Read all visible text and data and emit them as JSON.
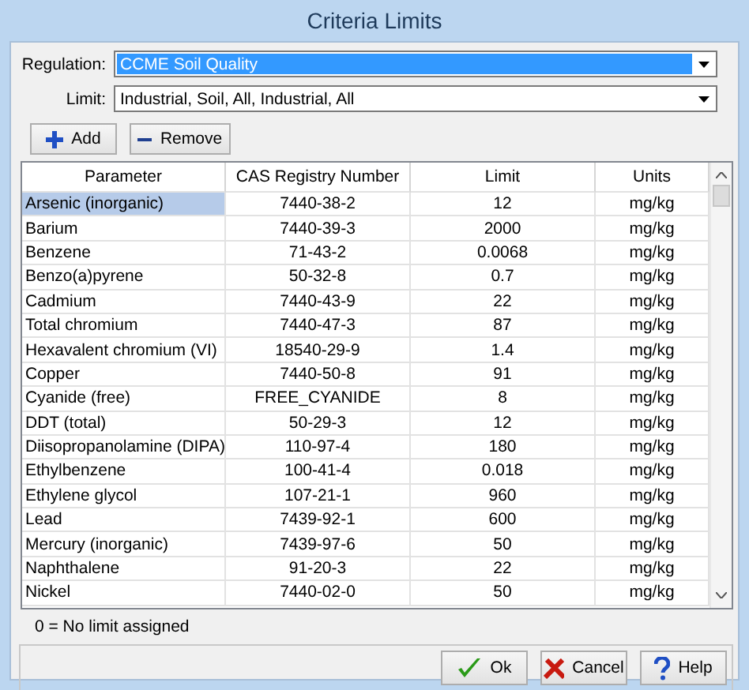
{
  "window": {
    "title": "Criteria Limits"
  },
  "regulation": {
    "label": "Regulation:",
    "value": "CCME Soil Quality",
    "highlighted": true
  },
  "limit": {
    "label": "Limit:",
    "value": "Industrial, Soil, All, Industrial, All",
    "highlighted": false
  },
  "toolbar": [
    {
      "kind": "add",
      "label": "Add"
    },
    {
      "kind": "remove",
      "label": "Remove"
    }
  ],
  "table": {
    "columns": [
      "Parameter",
      "CAS Registry Number",
      "Limit",
      "Units"
    ],
    "rows": [
      {
        "cells": [
          "Arsenic (inorganic)",
          "7440-38-2",
          "12",
          "mg/kg"
        ],
        "selected": true
      },
      {
        "cells": [
          "Barium",
          "7440-39-3",
          "2000",
          "mg/kg"
        ],
        "selected": false
      },
      {
        "cells": [
          "Benzene",
          "71-43-2",
          "0.0068",
          "mg/kg"
        ],
        "selected": false
      },
      {
        "cells": [
          "Benzo(a)pyrene",
          "50-32-8",
          "0.7",
          "mg/kg"
        ],
        "selected": false
      },
      {
        "cells": [
          "Cadmium",
          "7440-43-9",
          "22",
          "mg/kg"
        ],
        "selected": false
      },
      {
        "cells": [
          "Total chromium",
          "7440-47-3",
          "87",
          "mg/kg"
        ],
        "selected": false
      },
      {
        "cells": [
          "Hexavalent chromium (VI)",
          "18540-29-9",
          "1.4",
          "mg/kg"
        ],
        "selected": false
      },
      {
        "cells": [
          "Copper",
          "7440-50-8",
          "91",
          "mg/kg"
        ],
        "selected": false
      },
      {
        "cells": [
          "Cyanide (free)",
          "FREE_CYANIDE",
          "8",
          "mg/kg"
        ],
        "selected": false
      },
      {
        "cells": [
          "DDT (total)",
          "50-29-3",
          "12",
          "mg/kg"
        ],
        "selected": false
      },
      {
        "cells": [
          "Diisopropanolamine (DIPA)",
          "110-97-4",
          "180",
          "mg/kg"
        ],
        "selected": false
      },
      {
        "cells": [
          "Ethylbenzene",
          "100-41-4",
          "0.018",
          "mg/kg"
        ],
        "selected": false
      },
      {
        "cells": [
          "Ethylene glycol",
          "107-21-1",
          "960",
          "mg/kg"
        ],
        "selected": false
      },
      {
        "cells": [
          "Lead",
          "7439-92-1",
          "600",
          "mg/kg"
        ],
        "selected": false
      },
      {
        "cells": [
          "Mercury (inorganic)",
          "7439-97-6",
          "50",
          "mg/kg"
        ],
        "selected": false
      },
      {
        "cells": [
          "Naphthalene",
          "91-20-3",
          "22",
          "mg/kg"
        ],
        "selected": false
      },
      {
        "cells": [
          "Nickel",
          "7440-02-0",
          "50",
          "mg/kg"
        ],
        "selected": false
      }
    ]
  },
  "footnote": "0 = No limit assigned",
  "buttons": [
    {
      "kind": "ok",
      "label": "Ok"
    },
    {
      "kind": "cancel",
      "label": "Cancel"
    },
    {
      "kind": "help",
      "label": "Help"
    }
  ]
}
